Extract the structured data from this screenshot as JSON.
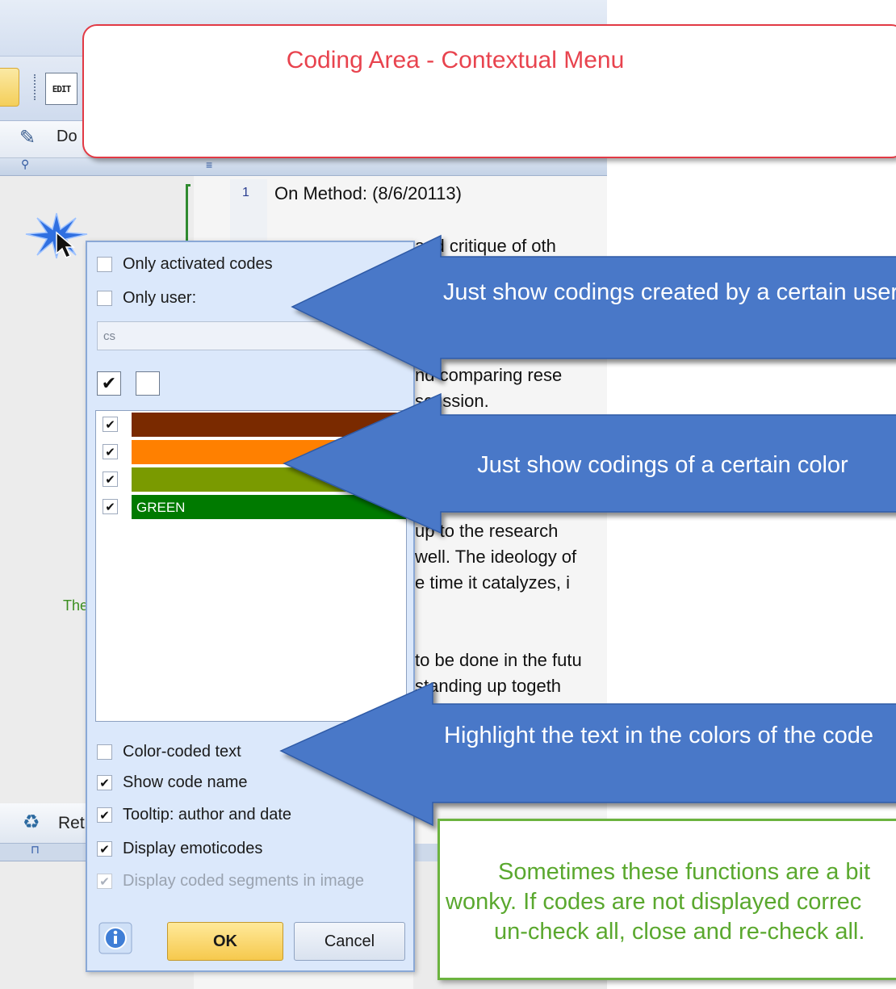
{
  "background_app": {
    "doc_tab_label": "Do",
    "retrieve_label": "Ret",
    "edit_icon_text": "EDIT",
    "left_pane_text": "The",
    "line_number": "1",
    "first_line": "On Method: (8/6/20113)",
    "text_fragments": [
      "and critique of oth",
      "nd comparing rese",
      "scussion.",
      "up to the research",
      "well. The ideology of",
      "e time it catalyzes, i",
      "to be done in the futu",
      "standing up togeth"
    ]
  },
  "popup": {
    "only_activated_codes": "Only activated codes",
    "only_user": "Only user:",
    "user_value": "cs",
    "color_rows": [
      {
        "color": "#7a2a00",
        "label": "",
        "checked": true
      },
      {
        "color": "#ff8000",
        "label": "",
        "checked": true
      },
      {
        "color": "#7a9a00",
        "label": "",
        "checked": true
      },
      {
        "color": "#007a00",
        "label": "GREEN",
        "checked": true
      }
    ],
    "color_coded_text": "Color-coded text",
    "show_code_name": "Show code name",
    "tooltip_author_date": "Tooltip: author and date",
    "display_emoticodes": "Display emoticodes",
    "display_coded_segments": "Display coded segments in image",
    "ok_label": "OK",
    "cancel_label": "Cancel",
    "check_glyph": "✔"
  },
  "callouts": {
    "title": "Coding Area - Contextual Menu",
    "arrow_user": "Just show codings created by a certain user",
    "arrow_color": "Just show codings of a certain color",
    "arrow_highlight": "Highlight the text in the colors of the code",
    "note_lines": [
      "Sometimes these functions are a bit",
      "wonky. If codes are not displayed correc",
      "un-check all, close and re-check all."
    ]
  },
  "colors": {
    "arrow_fill": "#4a78c8",
    "title_red": "#e8434e",
    "note_green": "#5aa82e"
  }
}
